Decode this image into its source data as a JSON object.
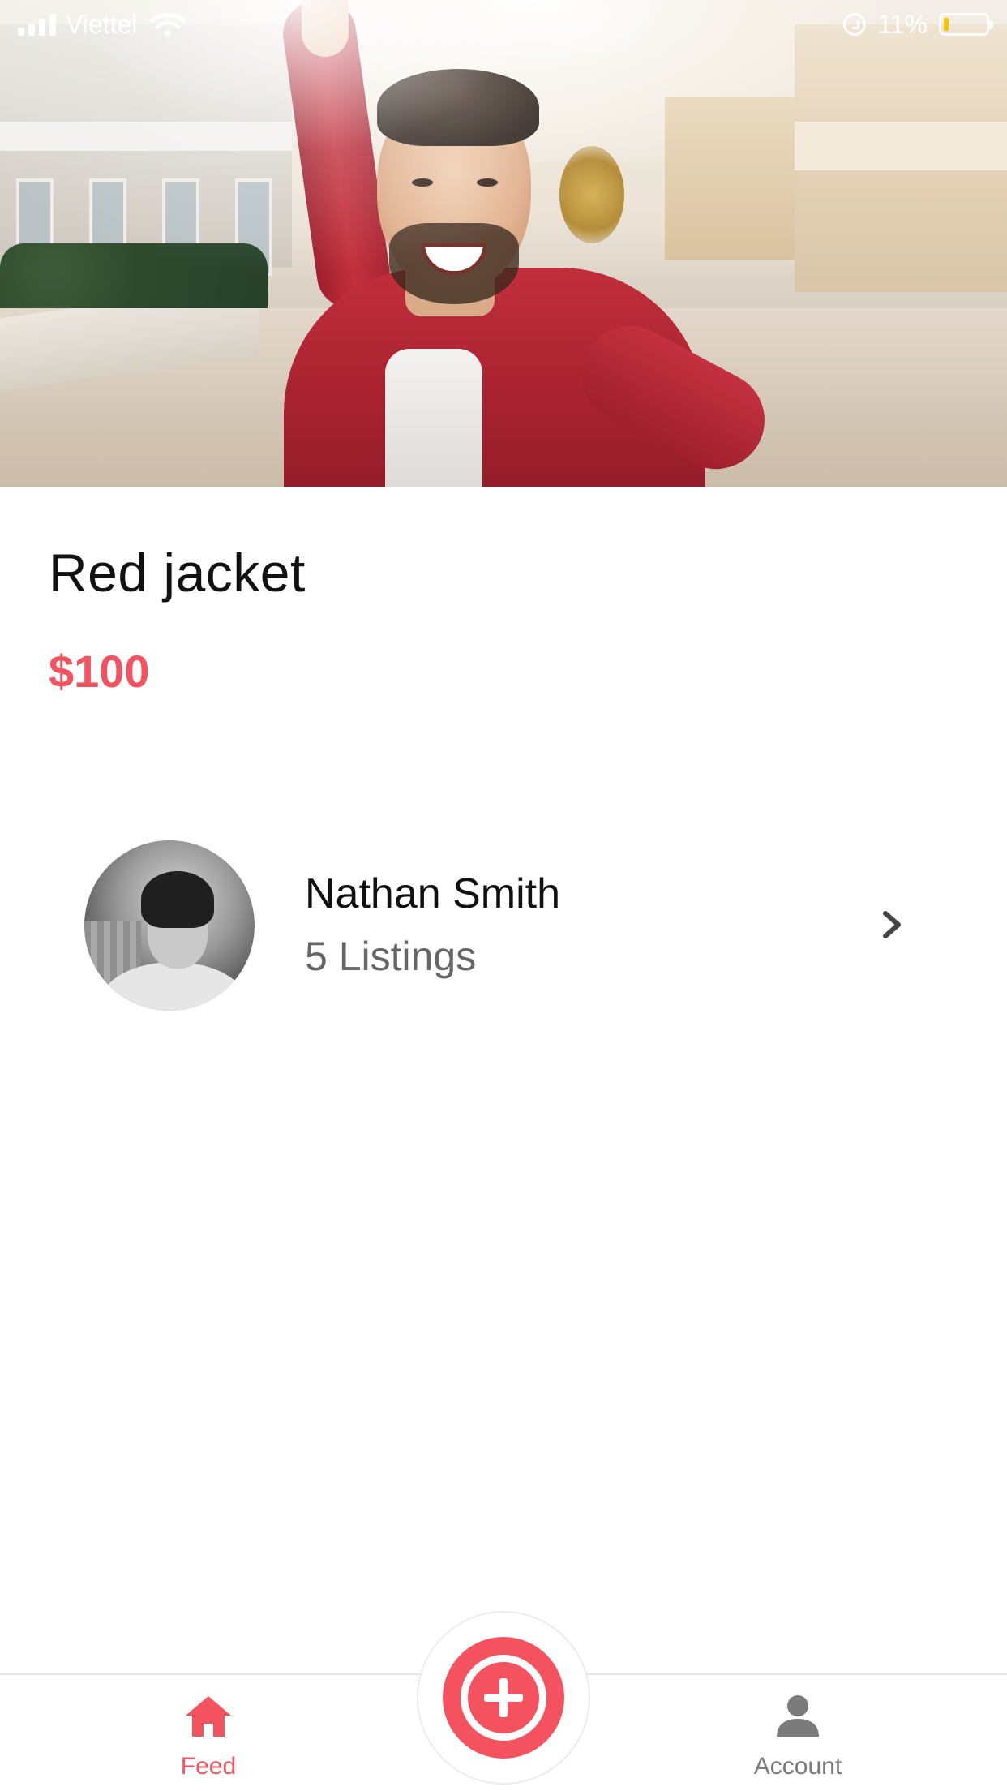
{
  "status_bar": {
    "carrier": "Viettel",
    "battery_percent": "11%"
  },
  "listing": {
    "title": "Red jacket",
    "price": "$100"
  },
  "seller": {
    "name": "Nathan Smith",
    "listings": "5 Listings"
  },
  "tab_bar": {
    "feed_label": "Feed",
    "account_label": "Account",
    "active_tab": "Feed"
  },
  "colors": {
    "accent": "#f4525f",
    "text_primary": "#111111",
    "text_secondary": "#666666",
    "tab_inactive": "#7b7b7b",
    "battery_low": "#f3c400"
  },
  "icons": {
    "signal": "signal-bars-icon",
    "wifi": "wifi-icon",
    "orientation_lock": "orientation-lock-icon",
    "battery": "battery-icon",
    "chevron": "chevron-right-icon",
    "feed": "home-icon",
    "add": "plus-icon",
    "account": "person-icon"
  }
}
